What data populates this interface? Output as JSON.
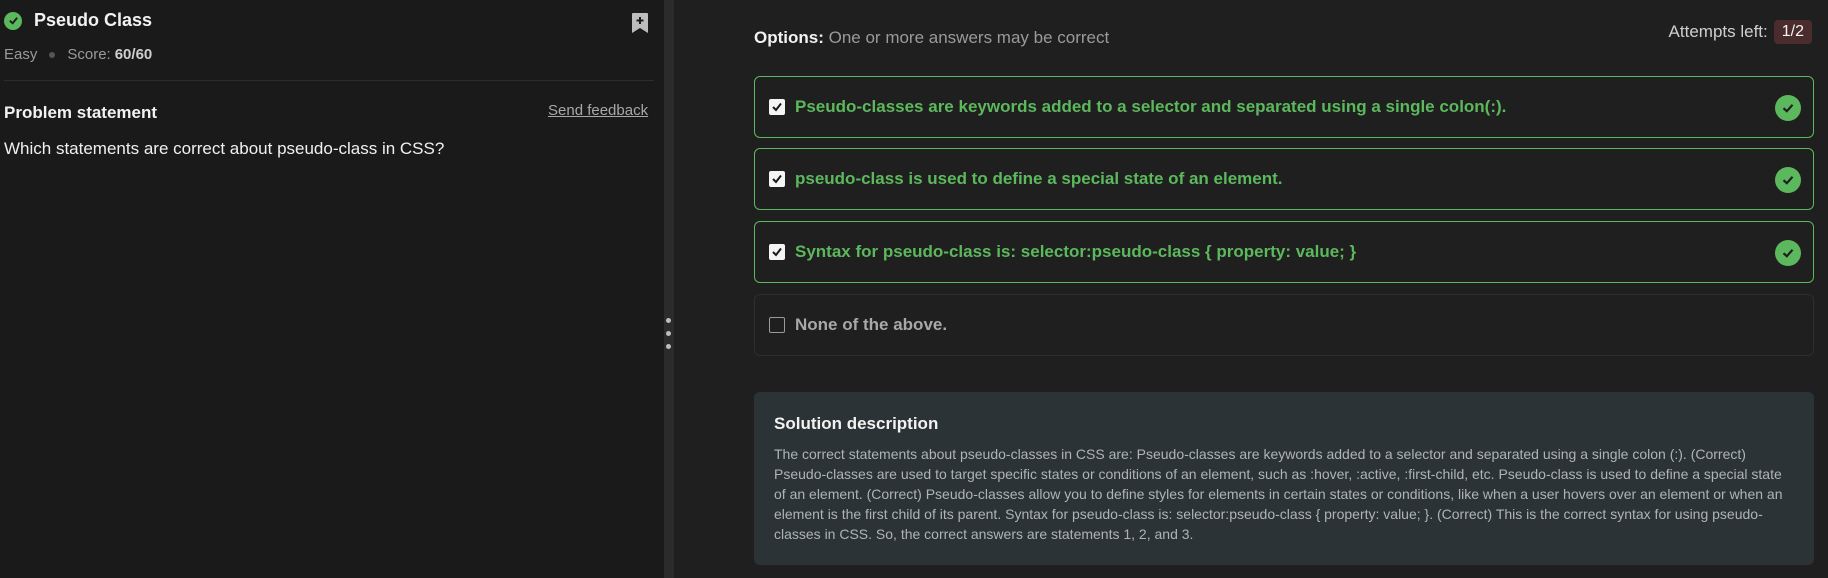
{
  "problem": {
    "title": "Pseudo Class",
    "difficulty": "Easy",
    "score_label": "Score:",
    "score_value": "60/60",
    "statement_heading": "Problem statement",
    "feedback_link": "Send feedback",
    "question": "Which statements are correct about pseudo-class in CSS?"
  },
  "options_header": {
    "label": "Options:",
    "hint": "One or more answers may be correct"
  },
  "attempts": {
    "label": "Attempts left:",
    "value": "1/2"
  },
  "options": [
    {
      "text": "Pseudo-classes are keywords added to a selector and separated using a single colon(:).",
      "checked": true,
      "correct": true
    },
    {
      "text": "pseudo-class is used to define a special state of an element.",
      "checked": true,
      "correct": true
    },
    {
      "text": "Syntax for pseudo-class is: selector:pseudo-class { property: value; }",
      "checked": true,
      "correct": true
    },
    {
      "text": "None of the above.",
      "checked": false,
      "correct": false
    }
  ],
  "solution": {
    "heading": "Solution description",
    "text": "The correct statements about pseudo-classes in CSS are: Pseudo-classes are keywords added to a selector and separated using a single colon (:). (Correct) Pseudo-classes are used to target specific states or conditions of an element, such as :hover, :active, :first-child, etc. Pseudo-class is used to define a special state of an element. (Correct) Pseudo-classes allow you to define styles for elements in certain states or conditions, like when a user hovers over an element or when an element is the first child of its parent. Syntax for pseudo-class is: selector:pseudo-class { property: value; }. (Correct) This is the correct syntax for using pseudo-classes in CSS. So, the correct answers are statements 1, 2, and 3."
  },
  "colors": {
    "correct": "#5cb85c",
    "attempts_badge": "#4a2c2c",
    "solution_bg": "#2b3336"
  },
  "icons": [
    "check-circle-icon",
    "bookmark-plus-icon",
    "checkbox-checked-icon",
    "checkbox-empty-icon",
    "drag-handle-icon"
  ]
}
